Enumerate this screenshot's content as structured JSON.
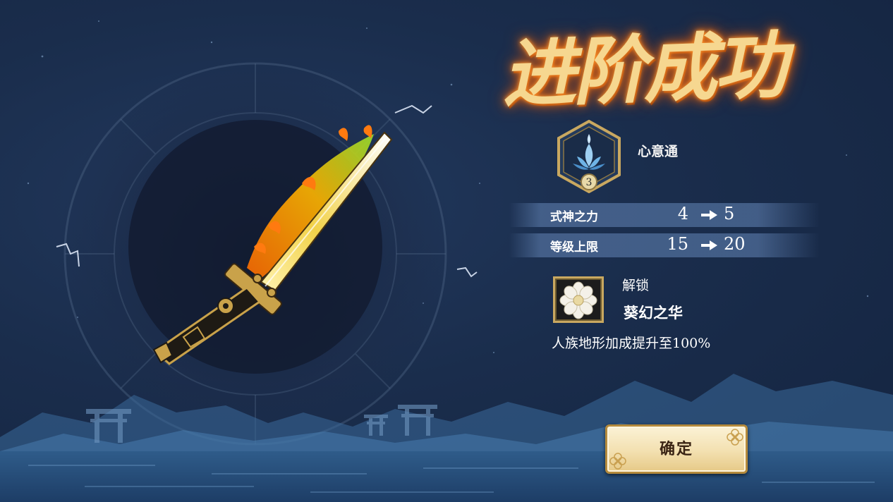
{
  "title": "进阶成功",
  "skill": {
    "name": "心意通",
    "level": "3",
    "icon": "lotus-icon"
  },
  "stats": [
    {
      "label": "式神之力",
      "from": "4",
      "to": "5"
    },
    {
      "label": "等级上限",
      "from": "15",
      "to": "20"
    }
  ],
  "unlock": {
    "label": "解锁",
    "name": "葵幻之华",
    "description": "人族地形加成提升至100%",
    "icon": "white-flower-icon"
  },
  "confirm_label": "确定",
  "featured_item": "flaming-sword",
  "colors": {
    "background": "#1a2d4c",
    "title_glow": "#ff9a30",
    "accent_gold": "#c9a860",
    "button_face": "#f3e0b0"
  }
}
